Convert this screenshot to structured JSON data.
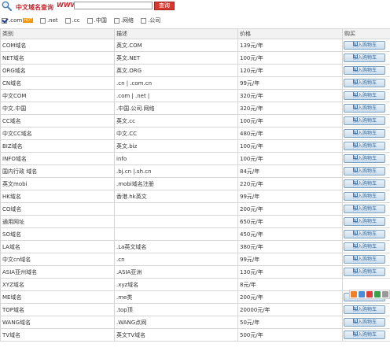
{
  "search": {
    "title": "中文域名查询",
    "www": "WWW.",
    "input_value": "",
    "button_label": "查询",
    "options": [
      {
        "label": ".com",
        "checked": true,
        "hot": "HOT"
      },
      {
        "label": ".net",
        "checked": false
      },
      {
        "label": ".cc",
        "checked": false
      },
      {
        "label": ".中国",
        "checked": false
      },
      {
        "label": ".网络",
        "checked": false
      },
      {
        "label": ".公司",
        "checked": false
      }
    ]
  },
  "table": {
    "headers": [
      "类别",
      "描述",
      "价格",
      "购买"
    ],
    "buy_label": "加入购物车",
    "rows": [
      {
        "category": "COM域名",
        "desc": "英文.COM",
        "price": "139元/年",
        "buy": true
      },
      {
        "category": "NET域名",
        "desc": "英文.NET",
        "price": "100元/年",
        "buy": true
      },
      {
        "category": "ORG域名",
        "desc": "英文.ORG",
        "price": "120元/年",
        "buy": true
      },
      {
        "category": "CN域名",
        "desc": ".cn | .com.cn",
        "price": "99元/年",
        "buy": true
      },
      {
        "category": "中文COM",
        "desc": ".com | .net |",
        "price": "320元/年",
        "buy": true
      },
      {
        "category": "中文.中国",
        "desc": ".中国.公司.网络",
        "price": "320元/年",
        "buy": true
      },
      {
        "category": "CC域名",
        "desc": "英文.cc",
        "price": "100元/年",
        "buy": true
      },
      {
        "category": "中文CC域名",
        "desc": "中文.CC",
        "price": "480元/年",
        "buy": true
      },
      {
        "category": "BIZ域名",
        "desc": "英文.biz",
        "price": "100元/年",
        "buy": true
      },
      {
        "category": "INFO域名",
        "desc": "info",
        "price": "100元/年",
        "buy": true
      },
      {
        "category": "国内行政 域名",
        "desc": ".bj.cn |.sh.cn",
        "price": "84元/年",
        "buy": true
      },
      {
        "category": "英文mobi",
        "desc": ".mobi域名注册",
        "price": "220元/年",
        "buy": true
      },
      {
        "category": "HK域名",
        "desc": "香港.hk英文",
        "price": "99元/年",
        "buy": true
      },
      {
        "category": "CO域名",
        "desc": "",
        "price": "200元/年",
        "buy": true
      },
      {
        "category": "通用网址",
        "desc": "",
        "price": "650元/年",
        "buy": true
      },
      {
        "category": "SO域名",
        "desc": "",
        "price": "450元/年",
        "buy": true
      },
      {
        "category": "LA域名",
        "desc": ".La英文域名",
        "price": "380元/年",
        "buy": true
      },
      {
        "category": "中文cn域名",
        "desc": ".cn",
        "price": "99元/年",
        "buy": true
      },
      {
        "category": "ASIA亚州域名",
        "desc": ".ASIA亚洲",
        "price": "130元/年",
        "buy": true
      },
      {
        "category": "XYZ域名",
        "desc": ".xyz域名",
        "price": "8元/年",
        "buy": false
      },
      {
        "category": "ME域名",
        "desc": ".me类",
        "price": "200元/年",
        "buy": true
      },
      {
        "category": "TOP域名",
        "desc": ".top顶",
        "price": "20000元/年",
        "buy": true
      },
      {
        "category": "WANG域名",
        "desc": ".WANG点网",
        "price": "50元/年",
        "buy": true
      },
      {
        "category": "TV域名",
        "desc": "英文TV域名",
        "price": "500元/年",
        "buy": true
      }
    ]
  },
  "share_icons": [
    "share-icon-orange",
    "share-icon-blue",
    "share-icon-red",
    "share-icon-green",
    "share-icon-gray"
  ]
}
